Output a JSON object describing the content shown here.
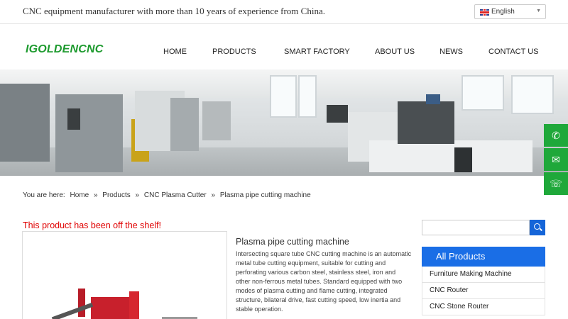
{
  "header": {
    "tagline": "CNC equipment manufacturer with more than 10 years of experience from China.",
    "language": "English"
  },
  "logo": "IGOLDENCNC",
  "nav": [
    "HOME",
    "PRODUCTS",
    "SMART FACTORY",
    "ABOUT US",
    "NEWS",
    "CONTACT US"
  ],
  "float_buttons": [
    "whatsapp-icon",
    "email-icon",
    "support-icon"
  ],
  "breadcrumb": {
    "prefix": "You are here:",
    "items": [
      "Home",
      "Products",
      "CNC Plasma Cutter",
      "Plasma pipe cutting machine"
    ],
    "separator": "»"
  },
  "product": {
    "notice": "This product has been off the shelf!",
    "title": "Plasma pipe cutting machine",
    "description": "Intersecting square tube CNC cutting machine is an automatic metal tube cutting equipment, suitable for cutting and perforating various carbon steel, stainless steel, iron and other non-ferrous metal tubes. Standard equipped with two modes of plasma cutting and flame cutting, integrated structure, bilateral drive, fast cutting speed, low inertia and stable operation."
  },
  "sidebar": {
    "search_placeholder": "",
    "categories_title": "All Products",
    "categories": [
      "Furniture Making Machine",
      "CNC Router",
      "CNC Stone Router"
    ]
  },
  "colors": {
    "accent_blue": "#1a6ee6",
    "green": "#1fa83a",
    "alert_red": "#e00000"
  }
}
